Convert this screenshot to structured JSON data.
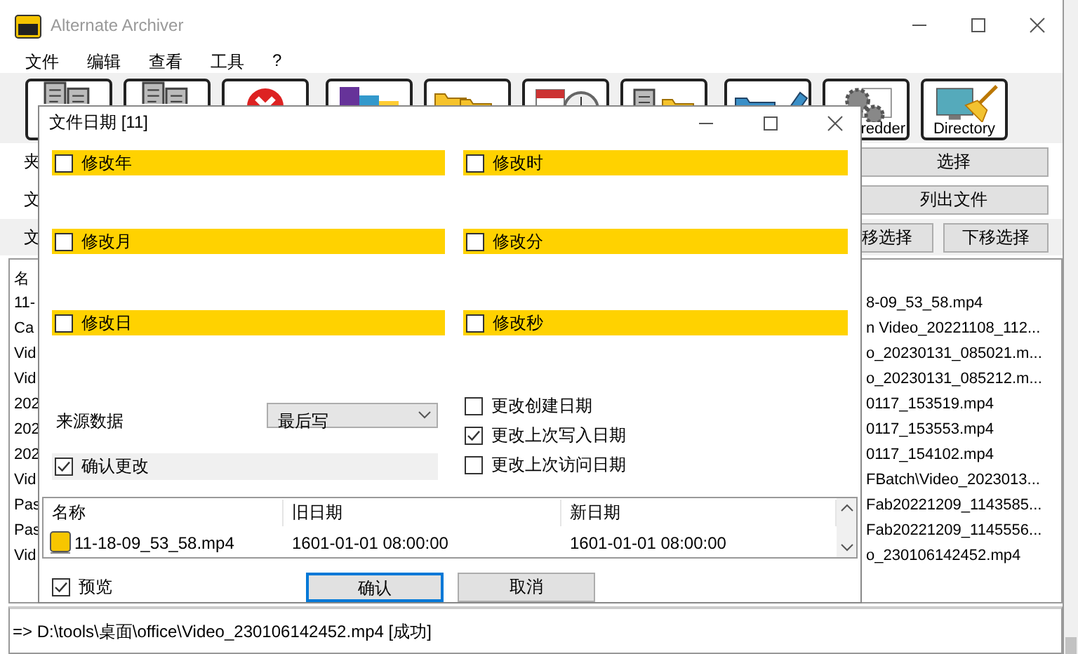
{
  "window": {
    "title": "Alternate Archiver"
  },
  "menu": [
    "文件",
    "编辑",
    "查看",
    "工具",
    "?"
  ],
  "toolbar": {
    "labels": [
      "redder",
      "Directory"
    ]
  },
  "form": {
    "labels": [
      "夹",
      "文",
      "文"
    ]
  },
  "side_buttons": [
    "选择",
    "列出文件"
  ],
  "move_buttons": [
    "移选择",
    "下移选择"
  ],
  "file_list": {
    "header": "名",
    "rows": [
      {
        "start": "11-",
        "end": "8-09_53_58.mp4"
      },
      {
        "start": "Ca",
        "end": "n Video_20221108_112..."
      },
      {
        "start": "Vid",
        "end": "o_20230131_085021.m..."
      },
      {
        "start": "Vid",
        "end": "o_20230131_085212.m..."
      },
      {
        "start": "202",
        "end": "0117_153519.mp4"
      },
      {
        "start": "202",
        "end": "0117_153553.mp4"
      },
      {
        "start": "202",
        "end": "0117_154102.mp4"
      },
      {
        "start": "Vid",
        "end": "FBatch\\Video_2023013..."
      },
      {
        "start": "Pas",
        "end": "Fab20221209_1143585..."
      },
      {
        "start": "Pas",
        "end": "Fab20221209_1145556..."
      },
      {
        "start": "Vid",
        "end": "o_230106142452.mp4"
      }
    ]
  },
  "log": [
    "=> D:\\tools\\桌面\\office\\Video_230106142452.mp4 [成功]"
  ],
  "dialog": {
    "title": "文件日期 [11]",
    "date_parts": [
      {
        "label": "修改年",
        "checked": false
      },
      {
        "label": "修改时",
        "checked": false
      },
      {
        "label": "修改月",
        "checked": false
      },
      {
        "label": "修改分",
        "checked": false
      },
      {
        "label": "修改日",
        "checked": false
      },
      {
        "label": "修改秒",
        "checked": false
      }
    ],
    "source": {
      "label": "来源数据",
      "value": "最后写"
    },
    "confirm_changes": {
      "label": "确认更改",
      "checked": true
    },
    "date_types": [
      {
        "label": "更改创建日期",
        "checked": false
      },
      {
        "label": "更改上次写入日期",
        "checked": true
      },
      {
        "label": "更改上次访问日期",
        "checked": false
      }
    ],
    "preview_table": {
      "columns": [
        "名称",
        "旧日期",
        "新日期"
      ],
      "rows": [
        {
          "name": "11-18-09_53_58.mp4",
          "old": "1601-01-01 08:00:00",
          "new": "1601-01-01 08:00:00"
        }
      ]
    },
    "preview": {
      "label": "预览",
      "checked": true
    },
    "buttons": [
      {
        "label": "确认",
        "default": true
      },
      {
        "label": "取消",
        "default": false
      }
    ]
  }
}
